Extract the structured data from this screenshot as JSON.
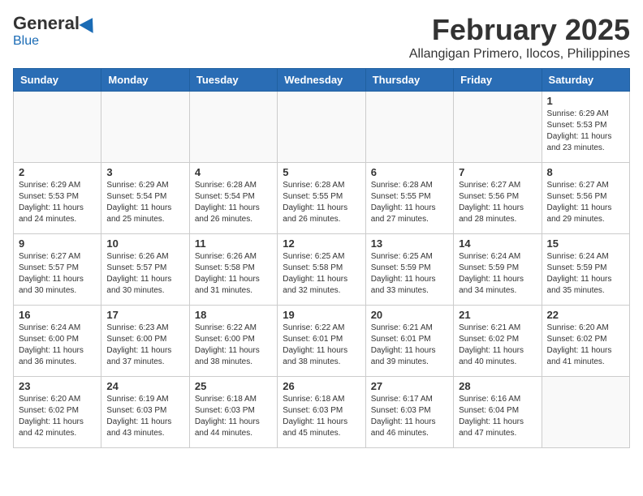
{
  "header": {
    "logo_general": "General",
    "logo_blue": "Blue",
    "month_title": "February 2025",
    "subtitle": "Allangigan Primero, Ilocos, Philippines"
  },
  "weekdays": [
    "Sunday",
    "Monday",
    "Tuesday",
    "Wednesday",
    "Thursday",
    "Friday",
    "Saturday"
  ],
  "weeks": [
    [
      {
        "day": "",
        "info": ""
      },
      {
        "day": "",
        "info": ""
      },
      {
        "day": "",
        "info": ""
      },
      {
        "day": "",
        "info": ""
      },
      {
        "day": "",
        "info": ""
      },
      {
        "day": "",
        "info": ""
      },
      {
        "day": "1",
        "info": "Sunrise: 6:29 AM\nSunset: 5:53 PM\nDaylight: 11 hours and 23 minutes."
      }
    ],
    [
      {
        "day": "2",
        "info": "Sunrise: 6:29 AM\nSunset: 5:53 PM\nDaylight: 11 hours and 24 minutes."
      },
      {
        "day": "3",
        "info": "Sunrise: 6:29 AM\nSunset: 5:54 PM\nDaylight: 11 hours and 25 minutes."
      },
      {
        "day": "4",
        "info": "Sunrise: 6:28 AM\nSunset: 5:54 PM\nDaylight: 11 hours and 26 minutes."
      },
      {
        "day": "5",
        "info": "Sunrise: 6:28 AM\nSunset: 5:55 PM\nDaylight: 11 hours and 26 minutes."
      },
      {
        "day": "6",
        "info": "Sunrise: 6:28 AM\nSunset: 5:55 PM\nDaylight: 11 hours and 27 minutes."
      },
      {
        "day": "7",
        "info": "Sunrise: 6:27 AM\nSunset: 5:56 PM\nDaylight: 11 hours and 28 minutes."
      },
      {
        "day": "8",
        "info": "Sunrise: 6:27 AM\nSunset: 5:56 PM\nDaylight: 11 hours and 29 minutes."
      }
    ],
    [
      {
        "day": "9",
        "info": "Sunrise: 6:27 AM\nSunset: 5:57 PM\nDaylight: 11 hours and 30 minutes."
      },
      {
        "day": "10",
        "info": "Sunrise: 6:26 AM\nSunset: 5:57 PM\nDaylight: 11 hours and 30 minutes."
      },
      {
        "day": "11",
        "info": "Sunrise: 6:26 AM\nSunset: 5:58 PM\nDaylight: 11 hours and 31 minutes."
      },
      {
        "day": "12",
        "info": "Sunrise: 6:25 AM\nSunset: 5:58 PM\nDaylight: 11 hours and 32 minutes."
      },
      {
        "day": "13",
        "info": "Sunrise: 6:25 AM\nSunset: 5:59 PM\nDaylight: 11 hours and 33 minutes."
      },
      {
        "day": "14",
        "info": "Sunrise: 6:24 AM\nSunset: 5:59 PM\nDaylight: 11 hours and 34 minutes."
      },
      {
        "day": "15",
        "info": "Sunrise: 6:24 AM\nSunset: 5:59 PM\nDaylight: 11 hours and 35 minutes."
      }
    ],
    [
      {
        "day": "16",
        "info": "Sunrise: 6:24 AM\nSunset: 6:00 PM\nDaylight: 11 hours and 36 minutes."
      },
      {
        "day": "17",
        "info": "Sunrise: 6:23 AM\nSunset: 6:00 PM\nDaylight: 11 hours and 37 minutes."
      },
      {
        "day": "18",
        "info": "Sunrise: 6:22 AM\nSunset: 6:00 PM\nDaylight: 11 hours and 38 minutes."
      },
      {
        "day": "19",
        "info": "Sunrise: 6:22 AM\nSunset: 6:01 PM\nDaylight: 11 hours and 38 minutes."
      },
      {
        "day": "20",
        "info": "Sunrise: 6:21 AM\nSunset: 6:01 PM\nDaylight: 11 hours and 39 minutes."
      },
      {
        "day": "21",
        "info": "Sunrise: 6:21 AM\nSunset: 6:02 PM\nDaylight: 11 hours and 40 minutes."
      },
      {
        "day": "22",
        "info": "Sunrise: 6:20 AM\nSunset: 6:02 PM\nDaylight: 11 hours and 41 minutes."
      }
    ],
    [
      {
        "day": "23",
        "info": "Sunrise: 6:20 AM\nSunset: 6:02 PM\nDaylight: 11 hours and 42 minutes."
      },
      {
        "day": "24",
        "info": "Sunrise: 6:19 AM\nSunset: 6:03 PM\nDaylight: 11 hours and 43 minutes."
      },
      {
        "day": "25",
        "info": "Sunrise: 6:18 AM\nSunset: 6:03 PM\nDaylight: 11 hours and 44 minutes."
      },
      {
        "day": "26",
        "info": "Sunrise: 6:18 AM\nSunset: 6:03 PM\nDaylight: 11 hours and 45 minutes."
      },
      {
        "day": "27",
        "info": "Sunrise: 6:17 AM\nSunset: 6:03 PM\nDaylight: 11 hours and 46 minutes."
      },
      {
        "day": "28",
        "info": "Sunrise: 6:16 AM\nSunset: 6:04 PM\nDaylight: 11 hours and 47 minutes."
      },
      {
        "day": "",
        "info": ""
      }
    ]
  ]
}
